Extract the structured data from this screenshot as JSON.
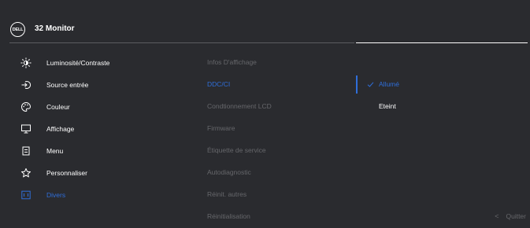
{
  "header": {
    "logo_text": "DELL",
    "title": "32 Monitor"
  },
  "menu": {
    "items": [
      {
        "label": "Luminosité/Contraste",
        "icon": "brightness-icon"
      },
      {
        "label": "Source entrée",
        "icon": "input-source-icon"
      },
      {
        "label": "Couleur",
        "icon": "palette-icon"
      },
      {
        "label": "Affichage",
        "icon": "display-icon"
      },
      {
        "label": "Menu",
        "icon": "menu-icon"
      },
      {
        "label": "Personnaliser",
        "icon": "star-icon"
      },
      {
        "label": "Divers",
        "icon": "others-icon"
      }
    ],
    "selected": "Divers"
  },
  "submenu": {
    "items": [
      "Infos D'affichage",
      "DDC/CI",
      "Condtionnement LCD",
      "Firmware",
      "Étiquette de service",
      "Autodiagnostic",
      "Réinit. autres",
      "Réinitialisation"
    ],
    "active": "DDC/CI"
  },
  "options": {
    "items": [
      "Allumé",
      "Eteint"
    ],
    "selected": "Allumé"
  },
  "footer": {
    "quit_label": "Quitter"
  },
  "colors": {
    "background": "#2a2b2f",
    "accent": "#2f6ed9",
    "dim_text": "#66676b",
    "text": "#ffffff"
  }
}
